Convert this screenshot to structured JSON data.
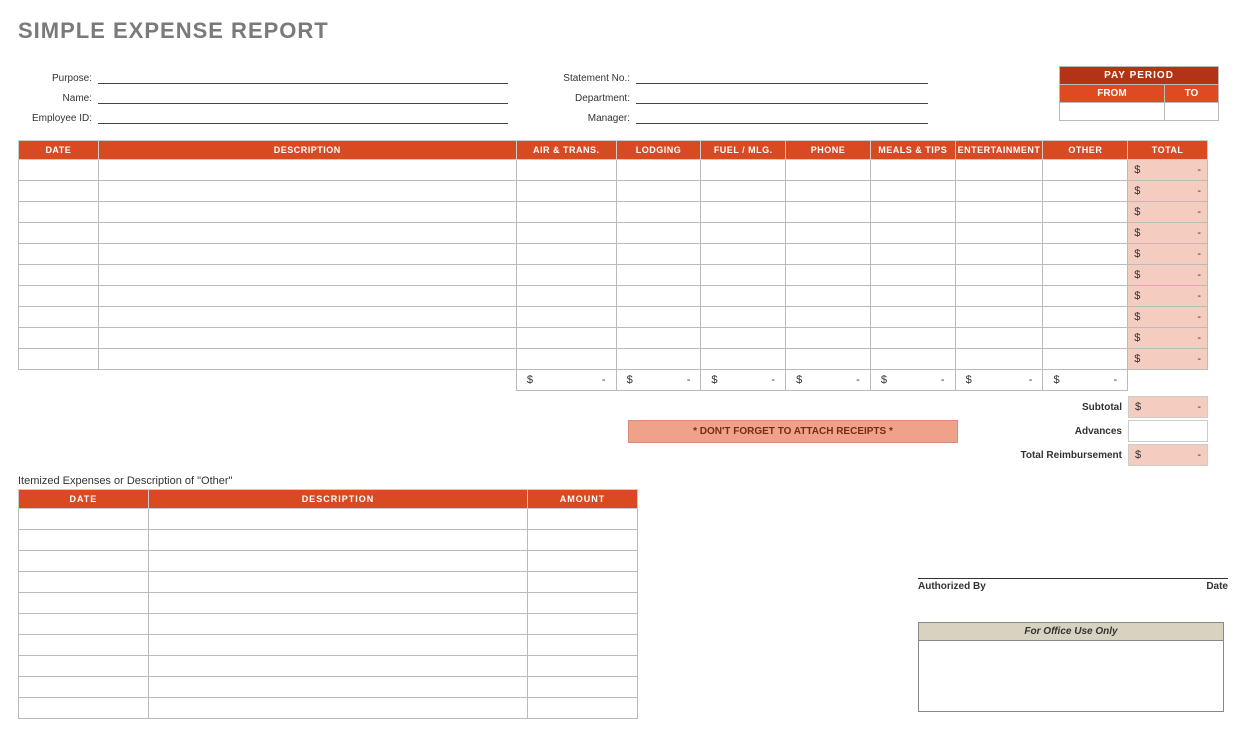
{
  "title": "SIMPLE EXPENSE REPORT",
  "fields_left": {
    "purpose": {
      "label": "Purpose:",
      "value": ""
    },
    "name": {
      "label": "Name:",
      "value": ""
    },
    "employee_id": {
      "label": "Employee ID:",
      "value": ""
    }
  },
  "fields_right": {
    "statement": {
      "label": "Statement No.:",
      "value": ""
    },
    "department": {
      "label": "Department:",
      "value": ""
    },
    "manager": {
      "label": "Manager:",
      "value": ""
    }
  },
  "pay_period": {
    "title": "PAY PERIOD",
    "from": {
      "label": "FROM",
      "value": ""
    },
    "to": {
      "label": "TO",
      "value": ""
    }
  },
  "columns": {
    "date": "DATE",
    "desc": "DESCRIPTION",
    "air": "AIR & TRANS.",
    "lodging": "LODGING",
    "fuel": "FUEL / MLG.",
    "phone": "PHONE",
    "meals": "MEALS & TIPS",
    "ent": "ENTERTAINMENT",
    "other": "OTHER",
    "total": "TOTAL"
  },
  "rows": [
    {
      "total_sym": "$",
      "total_dash": "-"
    },
    {
      "total_sym": "$",
      "total_dash": "-"
    },
    {
      "total_sym": "$",
      "total_dash": "-"
    },
    {
      "total_sym": "$",
      "total_dash": "-"
    },
    {
      "total_sym": "$",
      "total_dash": "-"
    },
    {
      "total_sym": "$",
      "total_dash": "-"
    },
    {
      "total_sym": "$",
      "total_dash": "-"
    },
    {
      "total_sym": "$",
      "total_dash": "-"
    },
    {
      "total_sym": "$",
      "total_dash": "-"
    },
    {
      "total_sym": "$",
      "total_dash": "-"
    }
  ],
  "col_sums": {
    "air": {
      "sym": "$",
      "dash": "-"
    },
    "lodging": {
      "sym": "$",
      "dash": "-"
    },
    "fuel": {
      "sym": "$",
      "dash": "-"
    },
    "phone": {
      "sym": "$",
      "dash": "-"
    },
    "meals": {
      "sym": "$",
      "dash": "-"
    },
    "ent": {
      "sym": "$",
      "dash": "-"
    },
    "other": {
      "sym": "$",
      "dash": "-"
    }
  },
  "receipt_note": "* DON'T FORGET TO ATTACH RECEIPTS *",
  "summary": {
    "subtotal": {
      "label": "Subtotal",
      "sym": "$",
      "dash": "-"
    },
    "advances": {
      "label": "Advances",
      "value": ""
    },
    "reimbursement": {
      "label": "Total Reimbursement",
      "sym": "$",
      "dash": "-"
    }
  },
  "itemized": {
    "caption": "Itemized Expenses or Description of \"Other\"",
    "cols": {
      "date": "DATE",
      "desc": "DESCRIPTION",
      "amount": "AMOUNT"
    },
    "row_count": 10
  },
  "auth": {
    "by": "Authorized By",
    "date": "Date"
  },
  "office": {
    "title": "For Office Use Only"
  }
}
